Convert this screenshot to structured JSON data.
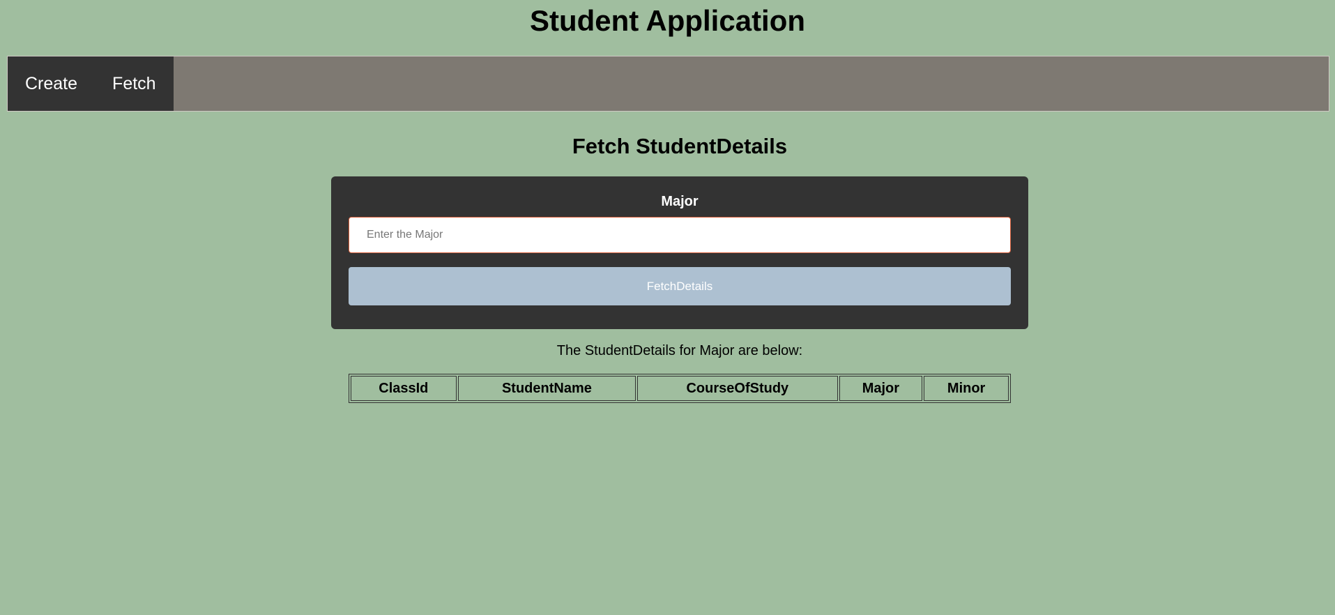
{
  "app": {
    "title": "Student Application"
  },
  "nav": {
    "items": [
      {
        "label": "Create"
      },
      {
        "label": "Fetch"
      }
    ]
  },
  "page": {
    "title": "Fetch StudentDetails"
  },
  "form": {
    "field_label": "Major",
    "input_placeholder": "Enter the Major",
    "input_value": "",
    "button_label": "FetchDetails"
  },
  "results": {
    "caption": "The StudentDetails for Major are below:",
    "columns": [
      "ClassId",
      "StudentName",
      "CourseOfStudy",
      "Major",
      "Minor"
    ],
    "rows": []
  },
  "colors": {
    "page_background": "#a0be9f",
    "navbar_background": "#7e7972",
    "nav_items_background": "#333333",
    "card_background": "#333333",
    "button_background": "#adc0d1",
    "input_border": "#d9603b"
  }
}
